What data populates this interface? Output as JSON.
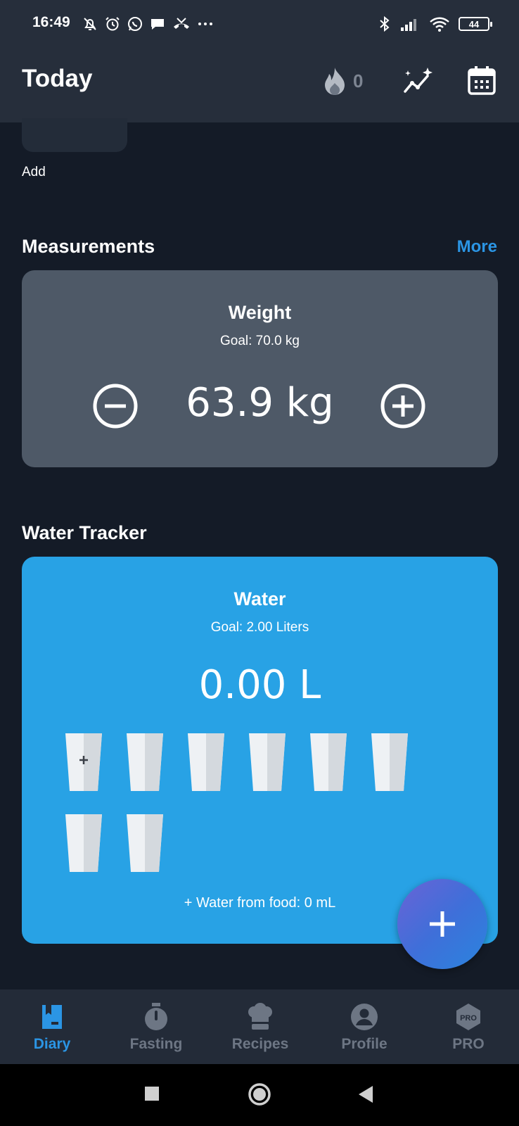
{
  "status": {
    "time": "16:49",
    "battery": "44"
  },
  "header": {
    "title": "Today",
    "streak_count": "0"
  },
  "top_tile": {
    "add_label": "Add"
  },
  "measurements": {
    "title": "Measurements",
    "more_label": "More",
    "card": {
      "title": "Weight",
      "goal": "Goal: 70.0 kg",
      "value": "63.9 kg"
    }
  },
  "water_tracker": {
    "title": "Water Tracker",
    "card": {
      "title": "Water",
      "goal": "Goal: 2.00 Liters",
      "value": "0.00 L",
      "food_note": "+ Water from food: 0 mL"
    },
    "glasses_total": 8,
    "glasses_filled": 0
  },
  "nav": {
    "items": [
      {
        "label": "Diary",
        "icon": "diary-icon",
        "active": true
      },
      {
        "label": "Fasting",
        "icon": "stopwatch-icon",
        "active": false
      },
      {
        "label": "Recipes",
        "icon": "chef-hat-icon",
        "active": false
      },
      {
        "label": "Profile",
        "icon": "profile-icon",
        "active": false
      },
      {
        "label": "PRO",
        "icon": "pro-badge-icon",
        "active": false
      }
    ],
    "pro_badge_text": "PRO"
  },
  "colors": {
    "accent": "#2b95e4",
    "water_card": "#28a2e5",
    "weight_card": "#4e5967",
    "background": "#141b27",
    "bar": "#262e3b"
  }
}
